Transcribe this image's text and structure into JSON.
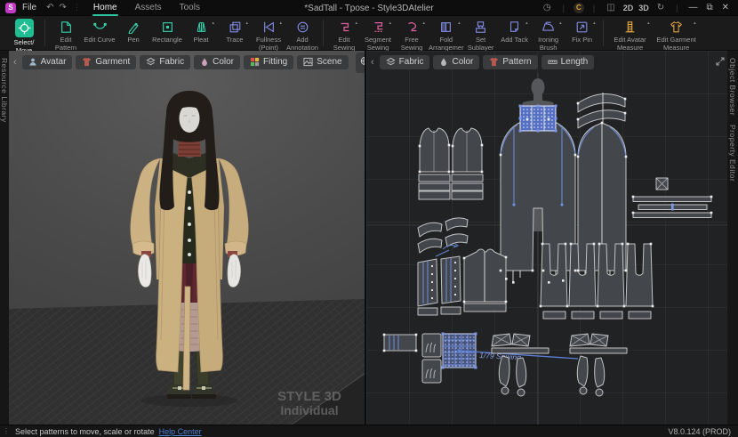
{
  "titlebar": {
    "logo_text": "S",
    "file_label": "File",
    "nav_tabs": [
      {
        "label": "Home",
        "active": true
      },
      {
        "label": "Assets",
        "active": false
      },
      {
        "label": "Tools",
        "active": false
      }
    ],
    "document_title": "*SadTall - Tpose - Style3DAtelier",
    "credits_badge": "C",
    "mode_2d": "2D",
    "mode_3d": "3D"
  },
  "ribbon": {
    "tools": [
      {
        "label": "Select/\nMove",
        "active": true
      },
      {
        "label": "Edit\nPattern"
      },
      {
        "label": "Edit Curve"
      },
      {
        "label": "Pen"
      },
      {
        "label": "Rectangle"
      },
      {
        "label": "Pleat"
      },
      {
        "label": "Trace"
      },
      {
        "label": "Fullness\n(Point)"
      },
      {
        "label": "Add\nAnnotation"
      },
      {
        "label": "Edit\nSewing"
      },
      {
        "label": "Segment\nSewing"
      },
      {
        "label": "Free\nSewing"
      },
      {
        "label": "Fold\nArrangemer"
      },
      {
        "label": "Set\nSublayer"
      },
      {
        "label": "Add Tack"
      },
      {
        "label": "Ironing\nBrush"
      },
      {
        "label": "Fix Pin"
      },
      {
        "label": "Edit Avatar\nMeasure"
      },
      {
        "label": "Edit Garment\nMeasure"
      }
    ]
  },
  "viewport3d": {
    "tabs": [
      {
        "label": "Avatar"
      },
      {
        "label": "Garment"
      },
      {
        "label": "Fabric"
      },
      {
        "label": "Color"
      },
      {
        "label": "Fitting"
      },
      {
        "label": "Scene"
      }
    ],
    "watermark": {
      "line1": "STYLE 3D",
      "line2": "Individual"
    }
  },
  "viewport2d": {
    "tabs": [
      {
        "label": "Fabric"
      },
      {
        "label": "Color"
      },
      {
        "label": "Pattern"
      },
      {
        "label": "Length"
      }
    ],
    "sewing_annotation": "1/79 Sewing"
  },
  "panels": {
    "left_vertical": "Resource Library",
    "right_vertical_top": "Object Browser",
    "right_vertical_bottom": "Property Editor"
  },
  "statusbar": {
    "message": "Select patterns to move, scale or rotate",
    "help_link": "Help Center",
    "version": "V8.0.124 (PROD)"
  },
  "colors": {
    "accent_teal": "#2bc5a1",
    "tool_teal": "#35cfa9",
    "tool_indigo": "#7f8ade",
    "tool_pink": "#e0609f",
    "tool_orange": "#dfa23e",
    "selection_blue": "#5d7fd8",
    "link_blue": "#4d7fd0",
    "logo_magenta": "#c23ac2"
  }
}
